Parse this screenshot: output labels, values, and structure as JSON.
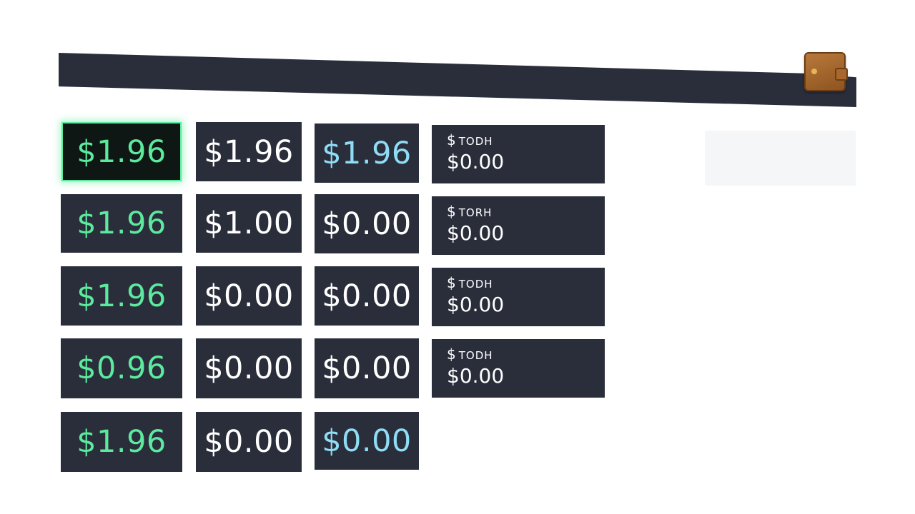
{
  "grid": {
    "col1": [
      "$1.96",
      "$1.96",
      "$1.96",
      "$0.96",
      "$1.96"
    ],
    "col2": [
      "$1.96",
      "$1.00",
      "$0.00",
      "$0.00",
      "$0.00"
    ],
    "col3": [
      "$1.96",
      "$0.00",
      "$0.00",
      "$0.00",
      "$0.00"
    ]
  },
  "wide_cards": [
    {
      "currency": "$",
      "code": "TODH",
      "amount": "$0.00"
    },
    {
      "currency": "$",
      "code": "TORH",
      "amount": "$0.00"
    },
    {
      "currency": "$",
      "code": "TODH",
      "amount": "$0.00"
    },
    {
      "currency": "$",
      "code": "TODH",
      "amount": "$0.00"
    }
  ],
  "icons": {
    "header": "wallet-icon"
  },
  "colors": {
    "tile_bg": "#2a2e3b",
    "accent_green": "#5bea9e",
    "accent_cyan": "#8fdcf5",
    "wallet_brown": "#a8672c"
  }
}
